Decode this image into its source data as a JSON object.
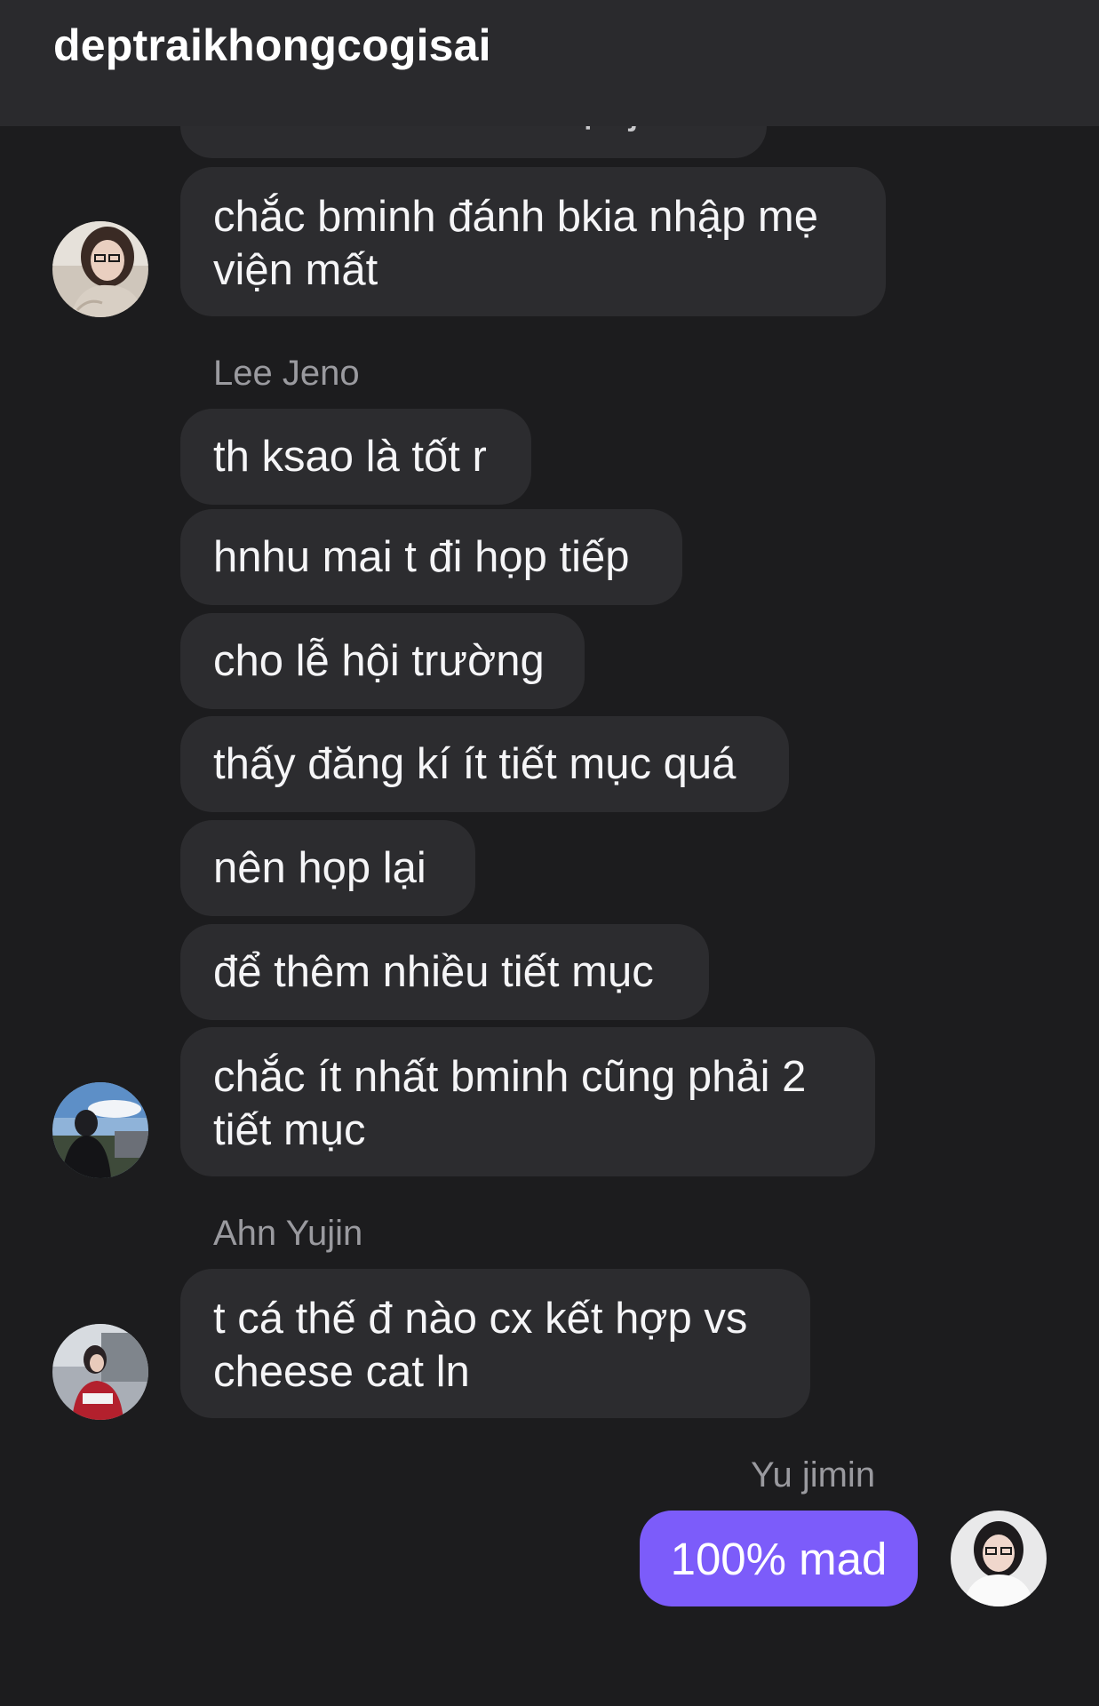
{
  "header": {
    "title": "deptraikhongcogisai"
  },
  "messages": {
    "partial_top": "đưa hoa mà ở có bịn jeno",
    "m1": "chắc bminh đánh bkia nhập mẹ viện mất",
    "sender_jeno": "Lee Jeno",
    "m2": "th ksao là tốt r",
    "m3": "hnhu mai t đi họp tiếp",
    "m4": "cho lễ hội trường",
    "m5": "thấy đăng kí ít tiết mục quá",
    "m6": "nên họp lại",
    "m7": "để thêm nhiều tiết mục",
    "m8": "chắc ít nhất bminh cũng phải 2 tiết mục",
    "sender_yujin": "Ahn Yujin",
    "m9": "t cá thế đ nào cx kết hợp vs cheese cat ln",
    "sender_jimin": "Yu jimin",
    "mine": "100% mad"
  },
  "colors": {
    "background": "#1c1c1e",
    "header": "#2a2a2d",
    "bubble_received": "#2c2c2f",
    "bubble_sent": "#7c5cfa",
    "sender_name": "#9a9a9f"
  },
  "icons": {
    "avatar_1": "avatar-girl-glasses",
    "avatar_2": "avatar-person-outdoor",
    "avatar_3": "avatar-girl-red-top",
    "avatar_self": "avatar-girl-white"
  }
}
